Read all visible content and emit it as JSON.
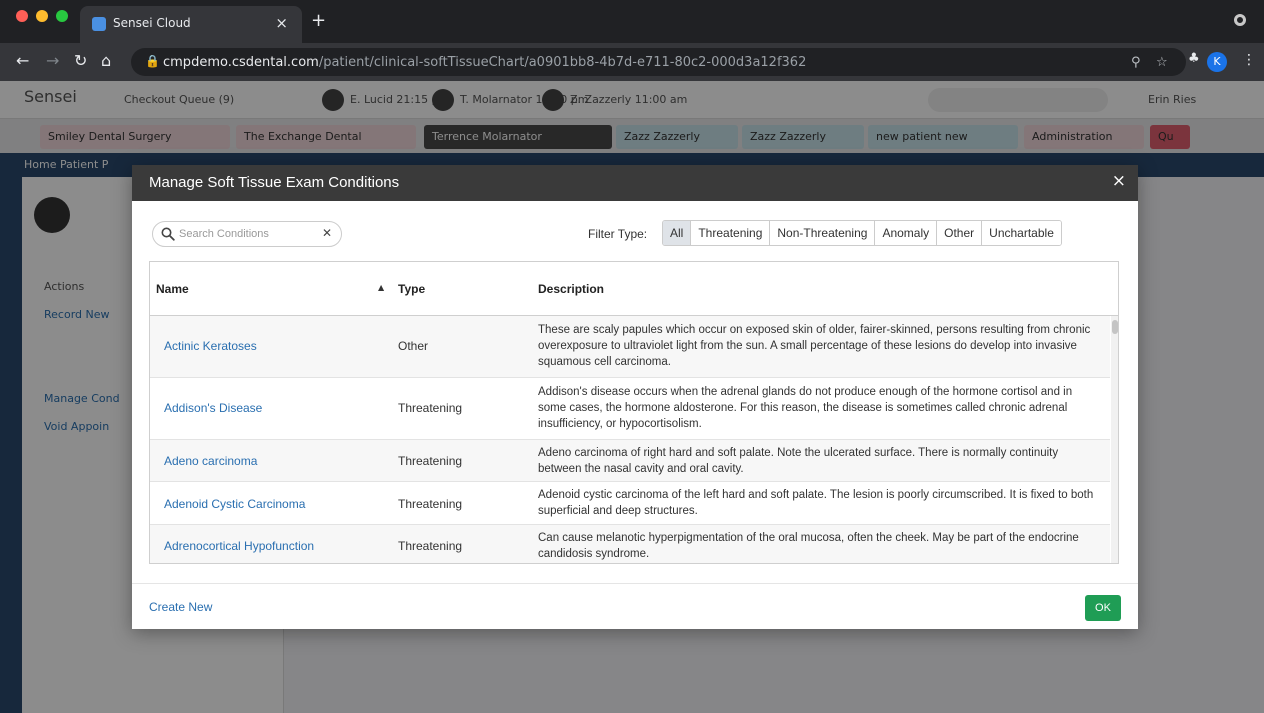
{
  "browser": {
    "tab_title": "Sensei Cloud",
    "tab_close": "×",
    "new_tab": "+",
    "url_host": "cmpdemo.csdental.com",
    "url_path": "/patient/clinical-softTissueChart/a0901bb8-4b7d-e711-80c2-000d3a12f362",
    "profile_initial": "K"
  },
  "app": {
    "logo": "Sensei",
    "header_items": [
      "Checkout Queue (9)",
      "E. Lucid 21:15 pm",
      "T. Molarnator 11:00 pm",
      "Z. Zazzerly 11:00 am",
      "Erin Ries"
    ],
    "patient_tabs": [
      "Smiley Dental Surgery",
      "The Exchange Dental",
      "Terrence Molarnator",
      "Zazz Zazzerly",
      "Zazz Zazzerly",
      "new patient new",
      "Administration",
      "Qu"
    ],
    "breadcrumb": "Home  Patient P",
    "side_items": [
      "Actions",
      "Record New",
      "Manage Cond",
      "Void Appoin"
    ]
  },
  "modal": {
    "title": "Manage Soft Tissue Exam Conditions",
    "close": "×",
    "search": {
      "placeholder": "Search Conditions",
      "value": ""
    },
    "filter_label": "Filter Type:",
    "filters": [
      "All",
      "Threatening",
      "Non-Threatening",
      "Anomaly",
      "Other",
      "Unchartable"
    ],
    "active_filter": "All",
    "columns": {
      "name": "Name",
      "type": "Type",
      "description": "Description"
    },
    "sort_indicator": "▲",
    "rows": [
      {
        "name": "Actinic Keratoses",
        "type": "Other",
        "description": "These are scaly papules which occur on exposed skin of older, fairer-skinned, persons resulting from chronic overexposure to ultraviolet light from the sun. A small percentage of these lesions do develop into invasive squamous cell carcinoma."
      },
      {
        "name": "Addison's Disease",
        "type": "Threatening",
        "description": "Addison's disease occurs when the adrenal glands do not produce enough of the hormone cortisol and in some cases, the hormone aldosterone. For this reason, the disease is sometimes called chronic adrenal insufficiency, or hypocortisolism."
      },
      {
        "name": "Adeno carcinoma",
        "type": "Threatening",
        "description": "Adeno carcinoma of right hard and soft palate. Note the ulcerated surface. There is normally continuity between the nasal cavity and oral cavity."
      },
      {
        "name": "Adenoid Cystic Carcinoma",
        "type": "Threatening",
        "description": "Adenoid cystic carcinoma of the left hard and soft palate. The lesion is poorly circumscribed. It is fixed to both superficial and deep structures."
      },
      {
        "name": "Adrenocortical Hypofunction",
        "type": "Threatening",
        "description": "Can cause melanotic hyperpigmentation of the oral mucosa, often the cheek. May be part of the endocrine candidosis syndrome."
      }
    ],
    "create_new": "Create New",
    "ok": "OK"
  },
  "colors": {
    "link": "#2a6fb0",
    "ok_button": "#1f9d55",
    "modal_header": "#3a3a3a"
  }
}
